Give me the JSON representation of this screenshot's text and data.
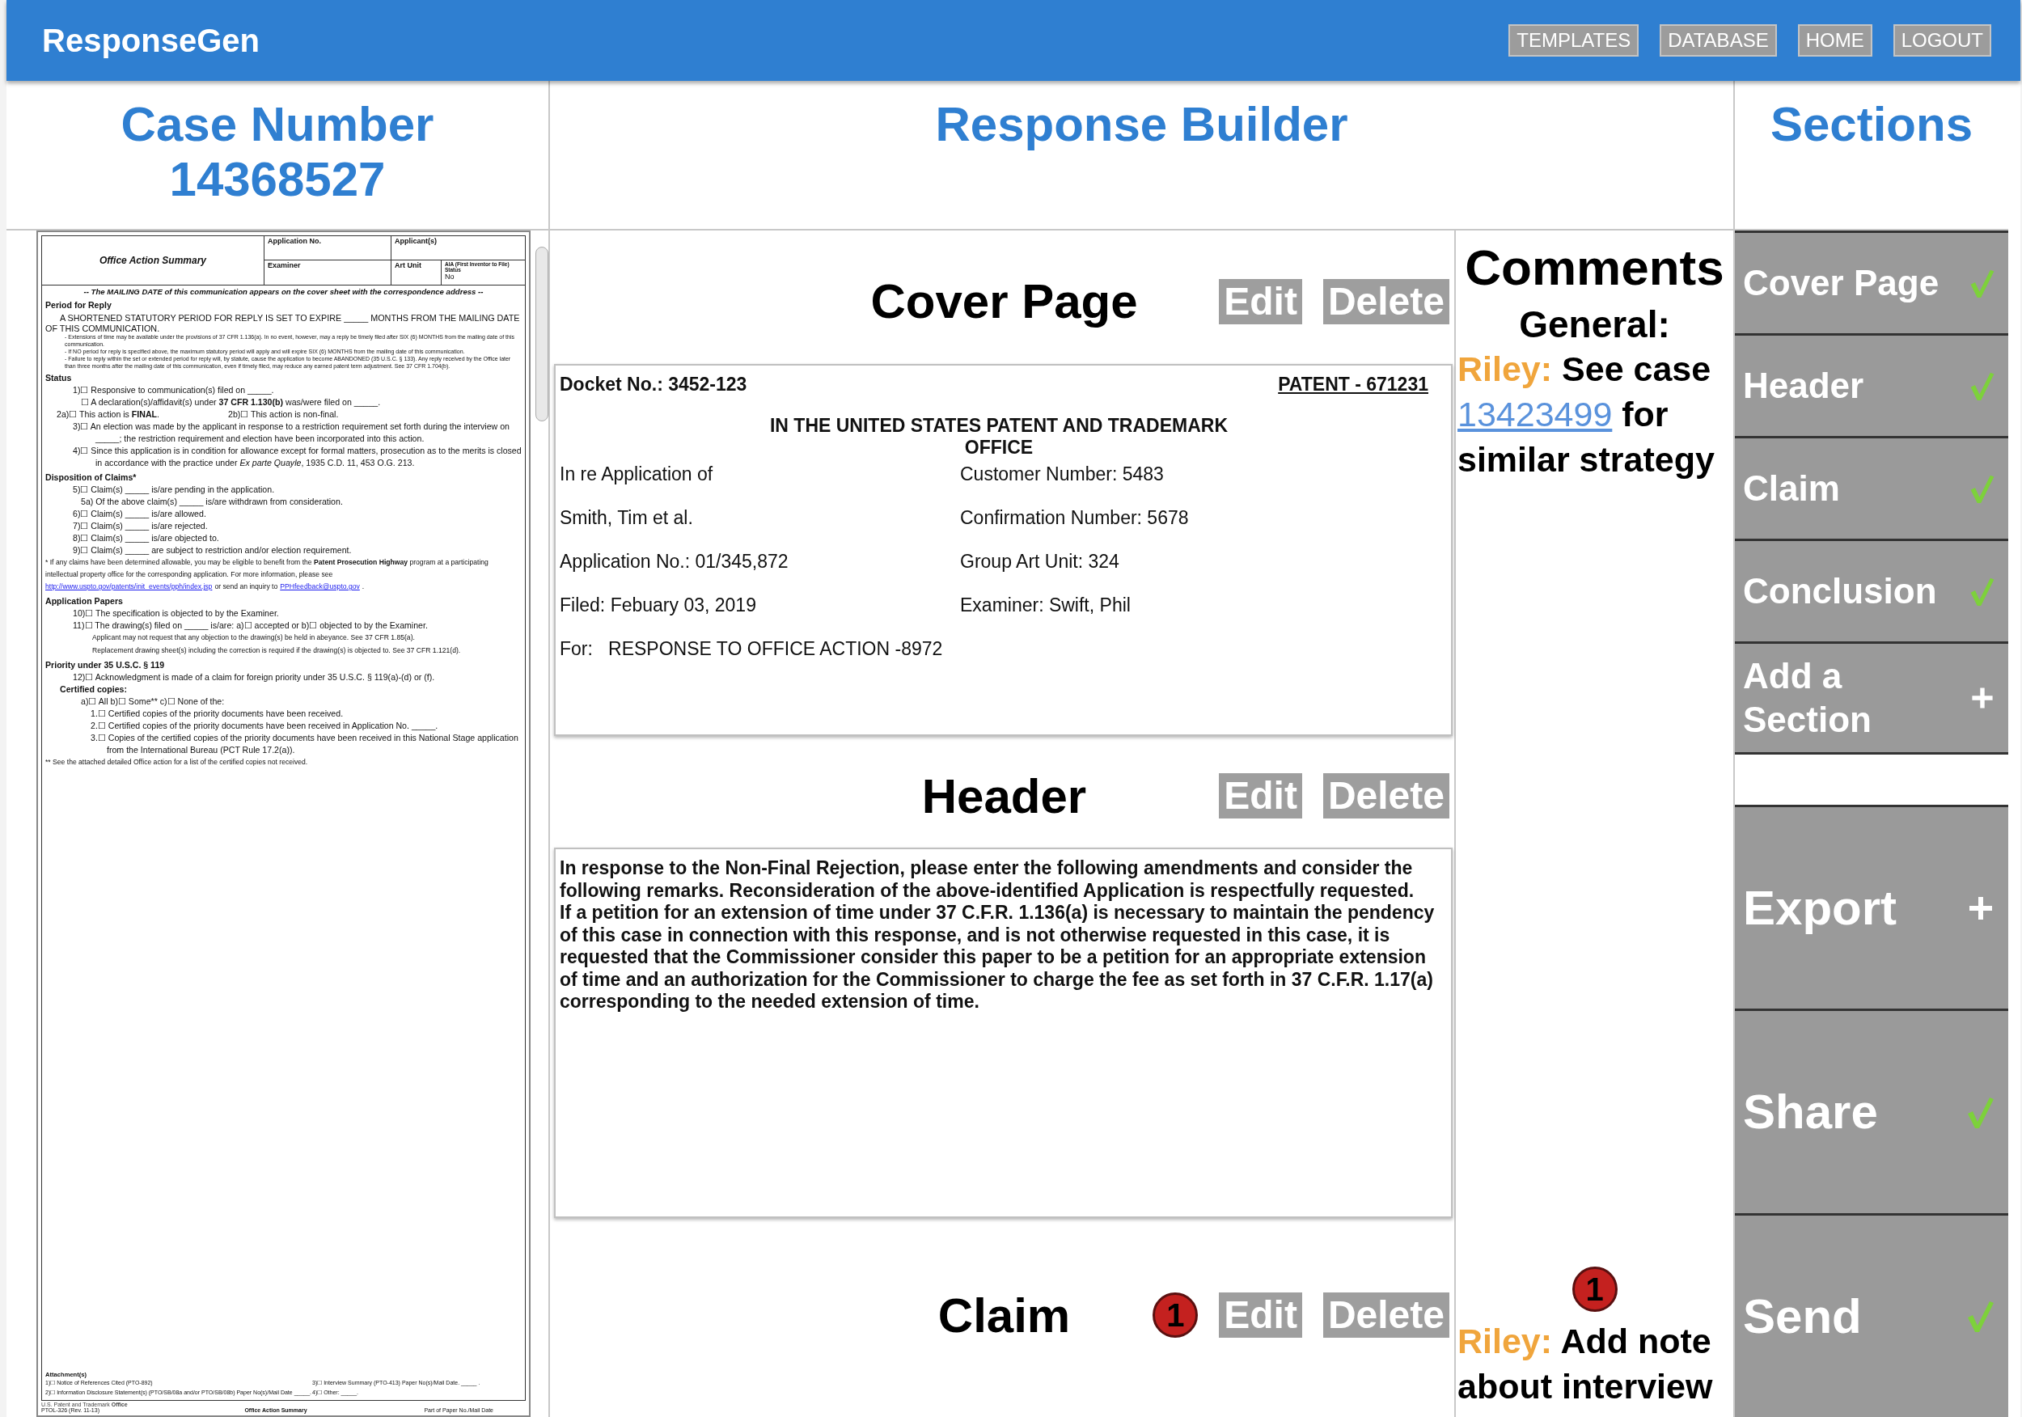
{
  "app": {
    "title": "ResponseGen",
    "nav": [
      "TEMPLATES",
      "DATABASE",
      "HOME",
      "LOGOUT"
    ]
  },
  "case": {
    "label": "Case Number",
    "number": "14368527"
  },
  "builder_title": "Response Builder",
  "sections_title": "Sections",
  "document": {
    "table": {
      "title": "Office Action Summary",
      "application_no": "Application No.",
      "applicants": "Applicant(s)",
      "examiner": "Examiner",
      "art_unit": "Art Unit",
      "aia_status": "AIA (First Inventor to File) Status",
      "aia_value": "No"
    },
    "lines": [
      {
        "kind": "notice",
        "text": "-- The MAILING DATE of this communication appears on the cover sheet with the correspondence address --"
      },
      {
        "kind": "heading",
        "text": "Period for Reply"
      },
      {
        "kind": "body",
        "text": "A SHORTENED STATUTORY PERIOD FOR REPLY IS SET TO EXPIRE _____ MONTHS FROM THE MAILING DATE OF THIS COMMUNICATION."
      },
      {
        "kind": "fine",
        "text": "- Extensions of time may be available under the provisions of 37 CFR 1.136(a). In no event, however, may a reply be timely filed after SIX (6) MONTHS from the mailing date of this communication."
      },
      {
        "kind": "fine",
        "text": "- If NO period for reply is specified above, the maximum statutory period will apply and will expire SIX (6) MONTHS from the mailing date of this communication."
      },
      {
        "kind": "fine",
        "text": "- Failure to reply within the set or extended period for reply will, by statute, cause the application to become ABANDONED (35 U.S.C. § 133). Any reply received by the Office later than three months after the mailing date of this communication, even if timely filed, may reduce any earned patent term adjustment. See 37 CFR 1.704(b)."
      },
      {
        "kind": "heading",
        "text": "Status"
      },
      {
        "kind": "item",
        "text": "1)☐ Responsive to communication(s) filed on _____."
      },
      {
        "kind": "item2",
        "text": "☐ A declaration(s)/affidavit(s) under **37 CFR 1.130(b)** was/were filed on _____."
      },
      {
        "kind": "pair",
        "texts": [
          "2a)☐ This action is **FINAL**.",
          "2b)☐ This action is non-final."
        ]
      },
      {
        "kind": "item",
        "text": "3)☐ An election was made by the applicant in response to a restriction requirement set forth during the interview on _____; the restriction requirement and election have been incorporated into this action."
      },
      {
        "kind": "item",
        "text": "4)☐ Since this application is in condition for allowance except for formal matters, prosecution as to the merits is closed in accordance with the practice under *Ex parte Quayle*, 1935 C.D. 11, 453 O.G. 213."
      },
      {
        "kind": "heading",
        "text": "Disposition of Claims*"
      },
      {
        "kind": "item",
        "text": "5)☐ Claim(s) _____ is/are pending in the application."
      },
      {
        "kind": "item2",
        "text": "5a) Of the above claim(s) _____ is/are withdrawn from consideration."
      },
      {
        "kind": "item",
        "text": "6)☐ Claim(s) _____ is/are allowed."
      },
      {
        "kind": "item",
        "text": "7)☐ Claim(s) _____ is/are rejected."
      },
      {
        "kind": "item",
        "text": "8)☐ Claim(s) _____ is/are objected to."
      },
      {
        "kind": "item",
        "text": "9)☐ Claim(s) _____ are subject to restriction and/or election requirement."
      },
      {
        "kind": "note",
        "text": "* If any claims have been determined allowable, you may be eligible to benefit from the **Patent Prosecution Highway** program at a participating intellectual property office for the corresponding application. For more information, please see"
      },
      {
        "kind": "links",
        "parts": [
          {
            "text": "http://www.uspto.gov/patents/init_events/pph/index.jsp",
            "link": true
          },
          {
            "text": "or send an inquiry to",
            "link": false
          },
          {
            "text": "PPHfeedback@uspto.gov",
            "link": true
          },
          {
            "text": ".",
            "link": false
          }
        ]
      },
      {
        "kind": "heading",
        "text": "Application Papers"
      },
      {
        "kind": "item",
        "text": "10)☐ The specification is objected to by the Examiner."
      },
      {
        "kind": "item",
        "text": "11)☐ The drawing(s) filed on _____ is/are: a)☐ accepted or b)☐ objected to by the Examiner."
      },
      {
        "kind": "sub",
        "text": "Applicant may not request that any objection to the drawing(s) be held in abeyance. See 37 CFR 1.85(a)."
      },
      {
        "kind": "sub",
        "text": "Replacement drawing sheet(s) including the correction is required if the drawing(s) is objected to. See 37 CFR 1.121(d)."
      },
      {
        "kind": "heading",
        "text": "Priority under 35 U.S.C. § 119"
      },
      {
        "kind": "item",
        "text": "12)☐ Acknowledgment is made of a claim for foreign priority under 35 U.S.C. § 119(a)-(d) or (f)."
      },
      {
        "kind": "subheading",
        "text": "Certified copies:"
      },
      {
        "kind": "item2",
        "text": "a)☐ All b)☐ Some** c)☐ None of the:"
      },
      {
        "kind": "item3",
        "text": "1.☐ Certified copies of the priority documents have been received."
      },
      {
        "kind": "item3",
        "text": "2.☐ Certified copies of the priority documents have been received in Application No. _____."
      },
      {
        "kind": "item3",
        "text": "3.☐ Copies of the certified copies of the priority documents have been received in this National Stage application from the International Bureau (PCT Rule 17.2(a))."
      },
      {
        "kind": "note",
        "text": "** See the attached detailed Office action for a list of the certified copies not received."
      }
    ],
    "attachments_title": "Attachment(s)",
    "attachments": [
      "1)☐ Notice of References Cited (PTO-892)",
      "3)☐ Interview Summary (PTO-413) Paper No(s)/Mail Date. _____ .",
      "2)☐ Information Disclosure Statement(s) (PTO/SB/08a and/or PTO/SB/08b) Paper No(s)/Mail Date _____.",
      "4)☐ Other: _____."
    ],
    "footer": {
      "office": "U.S. Patent and Trademark **Office**",
      "form": "PTOL-326 (Rev. 11-13)",
      "title": "Office Action Summary",
      "paper": "Part of Paper No./Mail Date"
    }
  },
  "cards": [
    {
      "title": "Cover Page",
      "kind": "cover",
      "buttons": [
        "Edit",
        "Delete"
      ],
      "docket": "Docket No.: 3452-123",
      "patent": "PATENT - 671231",
      "heading": "IN THE UNITED STATES PATENT AND TRADEMARK OFFICE",
      "rows": [
        [
          "In re Application of",
          "Customer Number: 5483"
        ],
        [
          "Smith, Tim et al.",
          "Confirmation Number: 5678"
        ],
        [
          "Application No.: 01/345,872",
          "Group Art Unit: 324"
        ],
        [
          "Filed: Febuary 03, 2019",
          "Examiner: Swift, Phil"
        ],
        [
          "For:   RESPONSE TO OFFICE ACTION -8972"
        ]
      ]
    },
    {
      "title": "Header",
      "kind": "text",
      "buttons": [
        "Edit",
        "Delete"
      ],
      "paragraphs": [
        "In response to the Non-Final Rejection, please enter the following amendments and consider the following remarks. Reconsideration of the above-identified Application is respectfully requested.",
        "If a petition for an extension of time under 37 C.F.R. 1.136(a) is necessary to maintain the pendency of this case in connection with this response, and is not otherwise requested in this case, it is requested that the Commissioner consider this paper to be a petition for an appropriate extension of time and an authorization for the Commissioner to charge the fee as set forth in 37 C.F.R. 1.17(a) corresponding to the needed extension of time."
      ]
    },
    {
      "title": "Claim",
      "kind": "empty",
      "badge": "1",
      "buttons": [
        "Edit",
        "Delete"
      ]
    }
  ],
  "comments": {
    "title": "Comments",
    "items": [
      {
        "heading": "General:",
        "author": "Riley:",
        "before": "See case",
        "link": "13423499",
        "after": "for similar strategy"
      },
      {
        "badge": "1",
        "author": "Riley:",
        "before": "Add note about interview"
      }
    ]
  },
  "sections": [
    {
      "label": "Cover Page",
      "kind": "check"
    },
    {
      "label": "Header",
      "kind": "check"
    },
    {
      "label": "Claim",
      "kind": "check"
    },
    {
      "label": "Conclusion",
      "kind": "check"
    },
    {
      "label": "Add a Section",
      "kind": "add"
    }
  ],
  "actions": [
    {
      "label": "Export",
      "kind": "add"
    },
    {
      "label": "Share",
      "kind": "check"
    },
    {
      "label": "Send",
      "kind": "check"
    }
  ]
}
